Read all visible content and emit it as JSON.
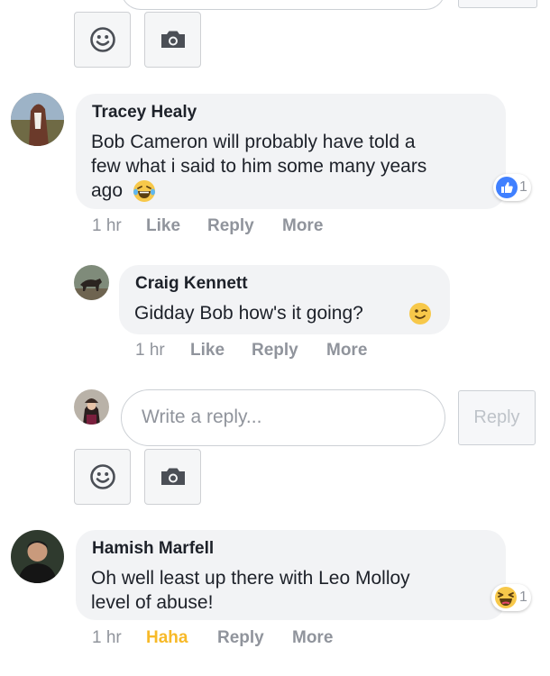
{
  "top_composer": {
    "emoji_icon": "smiley-icon",
    "camera_icon": "camera-icon"
  },
  "comments": [
    {
      "author": "Tracey Healy",
      "lines": [
        "Bob Cameron will probably have told a",
        "few what i said to him some many years",
        "ago"
      ],
      "emoji": "laughing-tears-icon",
      "reaction": {
        "icon": "like-icon",
        "count": "1"
      },
      "time": "1 hr",
      "actions": [
        "Like",
        "Reply",
        "More"
      ]
    },
    {
      "author": "Craig Kennett",
      "lines": [
        "Gidday Bob how's it going?"
      ],
      "emoji": "wink-icon",
      "time": "1 hr",
      "actions": [
        "Like",
        "Reply",
        "More"
      ]
    },
    {
      "author": "Hamish Marfell",
      "lines": [
        "Oh well least up there with Leo Molloy",
        "level of abuse!"
      ],
      "reaction": {
        "icon": "haha-icon",
        "count": "1"
      },
      "time": "1 hr",
      "actions": [
        "Haha",
        "Reply",
        "More"
      ]
    }
  ],
  "reply_composer": {
    "placeholder": "Write a reply...",
    "button_label": "Reply"
  },
  "colors": {
    "bubble": "#f2f3f5",
    "meta": "#90949c",
    "haha_active": "#f7b928",
    "like_blue": "#4080ff"
  }
}
